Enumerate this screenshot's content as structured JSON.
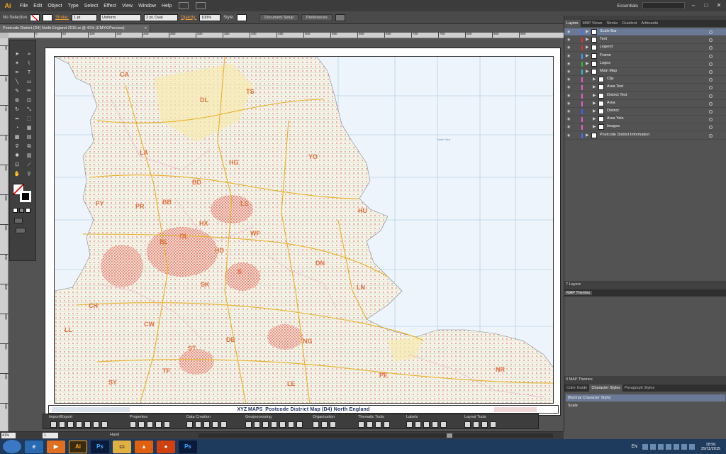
{
  "menu": {
    "logo": "Ai",
    "items": [
      "File",
      "Edit",
      "Object",
      "Type",
      "Select",
      "Effect",
      "View",
      "Window",
      "Help"
    ],
    "workspace": "Essentials",
    "win_min": "–",
    "win_max": "□",
    "win_close": "✕"
  },
  "control": {
    "selection": "No Selection",
    "stroke_label": "Stroke:",
    "stroke_weight": "1 pt",
    "profile": "Uniform",
    "brush": "2 pt. Oval",
    "opacity_label": "Opacity:",
    "opacity": "100%",
    "style_label": "Style:",
    "doc_setup": "Document Setup",
    "preferences": "Preferences"
  },
  "doc": {
    "tab_title": "Postcode District (D4) North England 2015.ai @ 41% (CMYK/Preview)",
    "tab_close": "×"
  },
  "ruler": {
    "h_ticks": [
      "0",
      "50",
      "100",
      "150",
      "200",
      "250",
      "300",
      "350",
      "400",
      "450",
      "500",
      "550",
      "600",
      "650",
      "700",
      "750",
      "800",
      "850",
      "900"
    ],
    "v_ticks": [
      "50",
      "100",
      "150",
      "200",
      "250",
      "300",
      "350",
      "400",
      "450",
      "500",
      "550",
      "600",
      "650"
    ]
  },
  "map": {
    "codes": [
      "CA",
      "DL",
      "TS",
      "LA",
      "HG",
      "YO",
      "BD",
      "FY",
      "PR",
      "BB",
      "LS",
      "HU",
      "HX",
      "WF",
      "BL",
      "OL",
      "HD",
      "DN",
      "S",
      "SK",
      "LN",
      "CH",
      "CW",
      "DE",
      "NG",
      "LL",
      "ST",
      "NR",
      "PE",
      "SY",
      "TF",
      "LE"
    ],
    "sea_label": "North Sea",
    "footer_brand": "XYZ MAPS",
    "footer_title": "Postcode District Map  (D4)  North England"
  },
  "bottom_toolbar": {
    "groups": [
      "Import/Export",
      "Properties",
      "Data Creation",
      "Geoprocessing",
      "Organization",
      "Thematic Tools",
      "Labels",
      "Layout Tools"
    ]
  },
  "status": {
    "zoom": "41%",
    "page": "1",
    "tool": "Hand"
  },
  "layers_panel": {
    "tabs": [
      "Layers",
      "MAP Views",
      "Stroke",
      "Gradient",
      "Artboards"
    ],
    "layers": [
      {
        "name": "Scale Bar",
        "color": "#4a6aff",
        "sub": false,
        "sel": true
      },
      {
        "name": "Text",
        "color": "#e03030",
        "sub": false,
        "sel": false
      },
      {
        "name": "Legend",
        "color": "#e03030",
        "sub": false,
        "sel": false
      },
      {
        "name": "Frame",
        "color": "#3aa0ff",
        "sub": false,
        "sel": false
      },
      {
        "name": "Logos",
        "color": "#30c030",
        "sub": false,
        "sel": false
      },
      {
        "name": "Main Map",
        "color": "#30c0c0",
        "sub": false,
        "sel": false
      },
      {
        "name": "Clip",
        "color": "#e060c0",
        "sub": true,
        "sel": false
      },
      {
        "name": "Area Text",
        "color": "#e060c0",
        "sub": true,
        "sel": false
      },
      {
        "name": "District Text",
        "color": "#e060c0",
        "sub": true,
        "sel": false
      },
      {
        "name": "Area",
        "color": "#e060c0",
        "sub": true,
        "sel": false
      },
      {
        "name": "District",
        "color": "#4060ff",
        "sub": true,
        "sel": false
      },
      {
        "name": "Area Yelo",
        "color": "#e060c0",
        "sub": true,
        "sel": false
      },
      {
        "name": "Images",
        "color": "#e060c0",
        "sub": true,
        "sel": false
      },
      {
        "name": "Postcode District Information",
        "color": "#4a6aff",
        "sub": false,
        "sel": false
      }
    ],
    "count": "7 Layers"
  },
  "map_themes": {
    "title": "MAP Themes",
    "count": "0 MAP Themes"
  },
  "char_styles": {
    "tabs": [
      "Color Guide",
      "Character Styles",
      "Paragraph Styles"
    ],
    "items": [
      "[Normal Character Style]",
      "Scale"
    ]
  },
  "taskbar": {
    "lang": "EN",
    "time": "18:56",
    "date": "29/11/2015"
  },
  "colors": {
    "accent": "#f7a51c",
    "code": "#e07040",
    "selection": "#6a7a96"
  }
}
